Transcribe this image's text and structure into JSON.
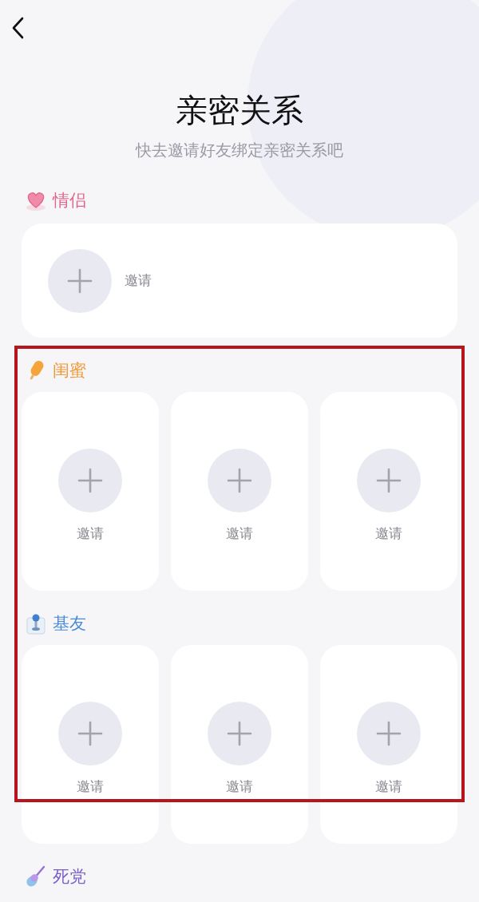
{
  "title": "亲密关系",
  "subtitle": "快去邀请好友绑定亲密关系吧",
  "highlight_frame": true,
  "sections": [
    {
      "name": "情侣",
      "kind": "wide",
      "color": "#e0658a",
      "slots": [
        {
          "label": "邀请"
        }
      ]
    },
    {
      "name": "闺蜜",
      "kind": "grid",
      "color": "#ee9a3a",
      "slots": [
        {
          "label": "邀请"
        },
        {
          "label": "邀请"
        },
        {
          "label": "邀请"
        }
      ]
    },
    {
      "name": "基友",
      "kind": "grid",
      "color": "#4a8ad4",
      "slots": [
        {
          "label": "邀请"
        },
        {
          "label": "邀请"
        },
        {
          "label": "邀请"
        }
      ]
    },
    {
      "name": "死党",
      "kind": "header",
      "color": "#7a5fc8"
    }
  ]
}
